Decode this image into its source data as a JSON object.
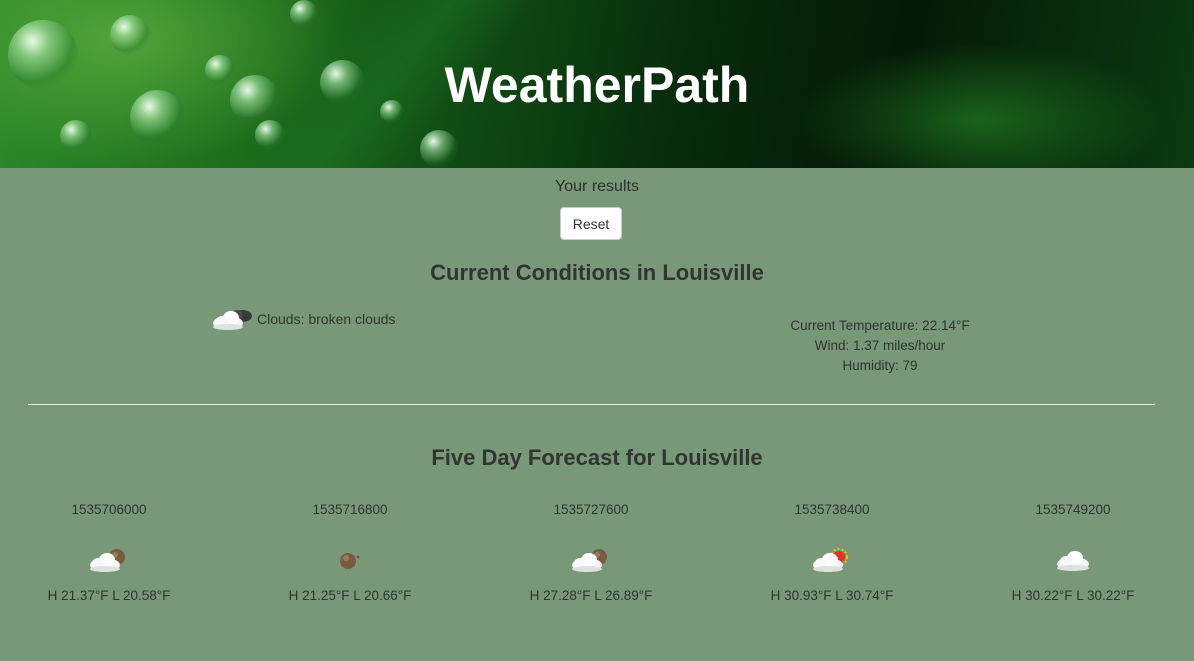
{
  "header": {
    "title": "WeatherPath"
  },
  "results": {
    "label": "Your results",
    "reset_label": "Reset"
  },
  "current": {
    "title": "Current Conditions in Louisville",
    "icon": "broken-clouds-icon",
    "clouds_text": "Clouds: broken clouds",
    "temperature": "Current Temperature: 22.14°F",
    "wind": "Wind: 1.37 miles/hour",
    "humidity": "Humidity: 79"
  },
  "forecast": {
    "title": "Five Day Forecast for Louisville",
    "days": [
      {
        "timestamp": "1535706000",
        "icon": "cloud-with-brown-orb-icon",
        "hl": "H 21.37°F L 20.58°F"
      },
      {
        "timestamp": "1535716800",
        "icon": "brown-orb-icon",
        "hl": "H 21.25°F L 20.66°F"
      },
      {
        "timestamp": "1535727600",
        "icon": "cloud-with-brown-orb-icon",
        "hl": "H 27.28°F L 26.89°F"
      },
      {
        "timestamp": "1535738400",
        "icon": "partly-cloudy-sun-icon",
        "hl": "H 30.93°F L 30.74°F"
      },
      {
        "timestamp": "1535749200",
        "icon": "cloud-icon",
        "hl": "H 30.22°F L 30.22°F"
      }
    ]
  },
  "colors": {
    "background": "#779977",
    "title": "#ffffff",
    "text": "#333333"
  }
}
